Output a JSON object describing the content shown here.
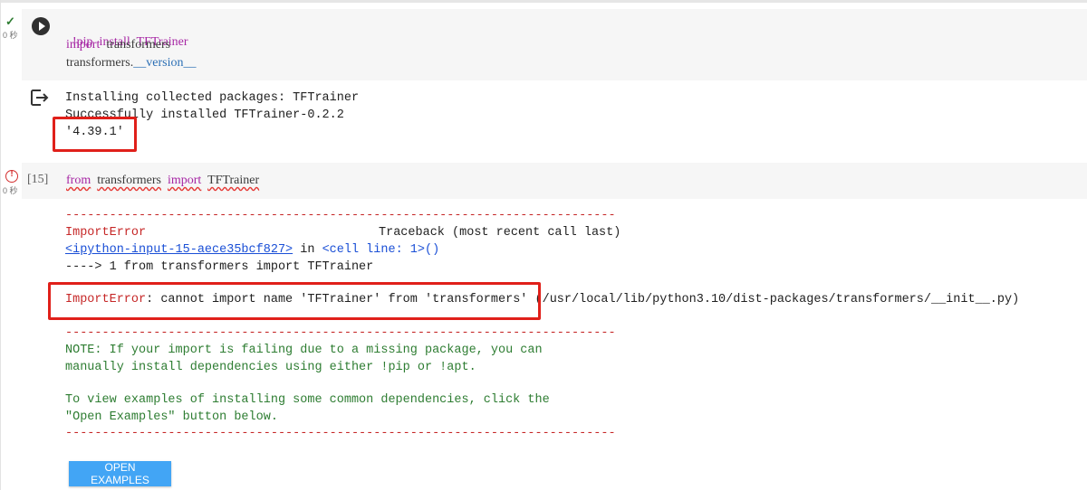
{
  "cell1": {
    "status_time": "0 秒",
    "code": {
      "line1": "!pip  install  TFTrainer",
      "line2_kw": "import",
      "line2_rest": "  transformers",
      "line3_a": "transformers.",
      "line3_b": "__version__"
    },
    "output": {
      "line1": "Installing collected packages: TFTrainer",
      "line2": "Successfully installed TFTrainer-0.2.2",
      "line3": "'4.39.1'"
    }
  },
  "cell2": {
    "status_time": "0 秒",
    "exec_count": "[15]",
    "code": {
      "kw_from": "from",
      "module": "transformers",
      "kw_import": "import",
      "name": "TFTrainer"
    },
    "output": {
      "dashes": "---------------------------------------------------------------------------",
      "error_type": "ImportError",
      "traceback_label": "Traceback (most recent call last)",
      "link_text": "<ipython-input-15-aece35bcf827>",
      "in_text": " in ",
      "cell_line": "<cell line: 1>()",
      "arrow_line": "----> 1 from transformers import TFTrainer",
      "err_name": "ImportError",
      "err_msg": ": cannot import name 'TFTrainer' from 'transformers'",
      "err_path": " (/usr/local/lib/python3.10/dist-packages/transformers/__init__.py)",
      "note1": "NOTE: If your import is failing due to a missing package, you can",
      "note2": "manually install dependencies using either !pip or !apt.",
      "note3": "To view examples of installing some common dependencies, click the",
      "note4": "\"Open Examples\" button below.",
      "button_label": "OPEN EXAMPLES"
    }
  }
}
